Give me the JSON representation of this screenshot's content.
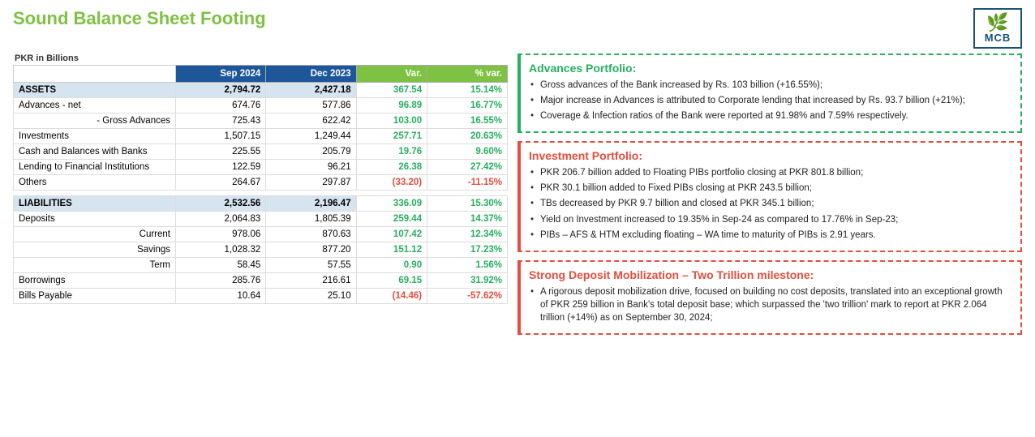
{
  "page": {
    "title": "Sound Balance Sheet Footing",
    "logo_text": "MCB",
    "logo_icon": "🌿"
  },
  "table": {
    "pkr_label": "PKR in Billions",
    "columns": [
      "",
      "Sep 2024",
      "Dec 2023",
      "Var.",
      "% var."
    ],
    "rows": [
      {
        "label": "ASSETS",
        "sep2024": "2,794.72",
        "dec2023": "2,427.18",
        "var": "367.54",
        "pvar": "15.14%",
        "type": "header"
      },
      {
        "label": "Advances - net",
        "sep2024": "674.76",
        "dec2023": "577.86",
        "var": "96.89",
        "pvar": "16.77%",
        "type": "normal"
      },
      {
        "label": "- Gross Advances",
        "sep2024": "725.43",
        "dec2023": "622.42",
        "var": "103.00",
        "pvar": "16.55%",
        "type": "indent2"
      },
      {
        "label": "Investments",
        "sep2024": "1,507.15",
        "dec2023": "1,249.44",
        "var": "257.71",
        "pvar": "20.63%",
        "type": "normal"
      },
      {
        "label": "Cash and Balances with Banks",
        "sep2024": "225.55",
        "dec2023": "205.79",
        "var": "19.76",
        "pvar": "9.60%",
        "type": "normal"
      },
      {
        "label": "Lending to Financial Institutions",
        "sep2024": "122.59",
        "dec2023": "96.21",
        "var": "26.38",
        "pvar": "27.42%",
        "type": "normal"
      },
      {
        "label": "Others",
        "sep2024": "264.67",
        "dec2023": "297.87",
        "var": "(33.20)",
        "pvar": "-11.15%",
        "type": "normal",
        "neg": true
      },
      {
        "label": "",
        "sep2024": "",
        "dec2023": "",
        "var": "",
        "pvar": "",
        "type": "gap"
      },
      {
        "label": "LIABILITIES",
        "sep2024": "2,532.56",
        "dec2023": "2,196.47",
        "var": "336.09",
        "pvar": "15.30%",
        "type": "header"
      },
      {
        "label": "Deposits",
        "sep2024": "2,064.83",
        "dec2023": "1,805.39",
        "var": "259.44",
        "pvar": "14.37%",
        "type": "normal"
      },
      {
        "label": "Current",
        "sep2024": "978.06",
        "dec2023": "870.63",
        "var": "107.42",
        "pvar": "12.34%",
        "type": "indent2"
      },
      {
        "label": "Savings",
        "sep2024": "1,028.32",
        "dec2023": "877.20",
        "var": "151.12",
        "pvar": "17.23%",
        "type": "indent2"
      },
      {
        "label": "Term",
        "sep2024": "58.45",
        "dec2023": "57.55",
        "var": "0.90",
        "pvar": "1.56%",
        "type": "indent2"
      },
      {
        "label": "Borrowings",
        "sep2024": "285.76",
        "dec2023": "216.61",
        "var": "69.15",
        "pvar": "31.92%",
        "type": "normal"
      },
      {
        "label": "Bills Payable",
        "sep2024": "10.64",
        "dec2023": "25.10",
        "var": "(14.46)",
        "pvar": "-57.62%",
        "type": "normal",
        "neg": true
      }
    ]
  },
  "panels": {
    "advances": {
      "title": "Advances Portfolio:",
      "bullets": [
        "Gross advances of the Bank increased by Rs. 103 billion (+16.55%);",
        "Major increase in Advances is attributed to Corporate lending that increased by Rs. 93.7 billion (+21%);",
        "Coverage & Infection ratios of the Bank were reported at 91.98% and 7.59% respectively."
      ]
    },
    "investment": {
      "title": "Investment Portfolio:",
      "bullets": [
        "PKR 206.7 billion added to Floating PIBs portfolio closing at PKR 801.8 billion;",
        "PKR 30.1 billion added to Fixed PIBs closing at PKR 243.5 billion;",
        "TBs decreased by PKR 9.7 billion and closed at PKR 345.1 billion;",
        "Yield on Investment increased to 19.35% in Sep-24 as compared to 17.76% in Sep-23;",
        "PIBs – AFS & HTM excluding floating – WA time to maturity of PIBs is 2.91 years."
      ]
    },
    "deposit": {
      "title": "Strong Deposit Mobilization – Two Trillion milestone:",
      "bullets": [
        "A rigorous deposit mobilization drive, focused on building no cost deposits, translated into an exceptional growth of PKR 259 billion in Bank's total deposit base; which surpassed the 'two trillion' mark to report at PKR 2.064 trillion (+14%) as on September 30, 2024;"
      ]
    }
  }
}
